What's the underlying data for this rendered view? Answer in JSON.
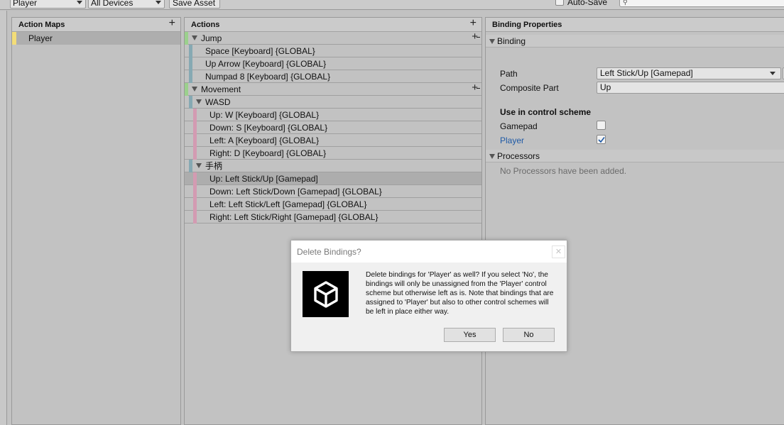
{
  "toolbar": {
    "control_scheme": "Player",
    "devices": "All Devices",
    "save_asset": "Save Asset",
    "auto_save_label": "Auto-Save",
    "auto_save_checked": false
  },
  "action_maps": {
    "header": "Action Maps",
    "items": [
      {
        "label": "Player",
        "selected": true
      }
    ]
  },
  "actions": {
    "header": "Actions",
    "rows": [
      {
        "label": "Jump"
      },
      {
        "label": "Space [Keyboard] {GLOBAL}"
      },
      {
        "label": "Up Arrow [Keyboard] {GLOBAL}"
      },
      {
        "label": "Numpad 8 [Keyboard] {GLOBAL}"
      },
      {
        "label": "Movement"
      },
      {
        "label": "WASD"
      },
      {
        "label": "Up: W [Keyboard] {GLOBAL}"
      },
      {
        "label": "Down: S [Keyboard] {GLOBAL}"
      },
      {
        "label": "Left: A [Keyboard] {GLOBAL}"
      },
      {
        "label": "Right: D [Keyboard] {GLOBAL}"
      },
      {
        "label": "手柄"
      },
      {
        "label": "Up: Left Stick/Up [Gamepad]",
        "selected": true
      },
      {
        "label": "Down: Left Stick/Down [Gamepad] {GLOBAL}"
      },
      {
        "label": "Left: Left Stick/Left [Gamepad] {GLOBAL}"
      },
      {
        "label": "Right: Left Stick/Right [Gamepad] {GLOBAL}"
      }
    ]
  },
  "properties": {
    "header": "Binding Properties",
    "binding_section": "Binding",
    "path_label": "Path",
    "path_value": "Left Stick/Up [Gamepad]",
    "composite_label": "Composite Part",
    "composite_value": "Up",
    "use_in_scheme": "Use in control scheme",
    "schemes": [
      {
        "label": "Gamepad",
        "checked": false
      },
      {
        "label": "Player",
        "checked": true
      }
    ],
    "processors_section": "Processors",
    "processors_empty": "No Processors have been added."
  },
  "dialog": {
    "title": "Delete Bindings?",
    "message": "Delete bindings for 'Player' as well? If you select 'No', the bindings will only be unassigned from the 'Player' control scheme but otherwise left as is. Note that bindings that are assigned to 'Player' but also to other control schemes will be left in place either way.",
    "yes": "Yes",
    "no": "No"
  },
  "colors": {
    "action_marker": "#9bd08d",
    "binding_marker": "#86a9b3",
    "composite_part_marker": "#d39bb2",
    "map_marker": "#f3dd78",
    "link_blue": "#1f5aa6"
  }
}
